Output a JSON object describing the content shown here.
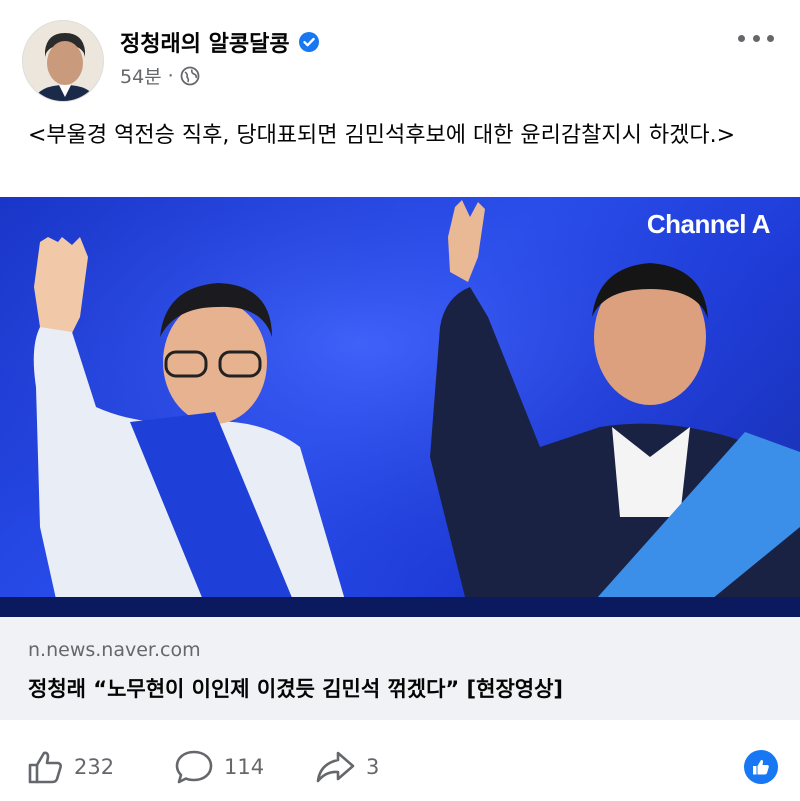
{
  "post": {
    "author": "정청래의 알콩달콩",
    "time": "54분",
    "separator": "·",
    "text": "<부울경 역전승 직후, 당대표되면 김민석후보에 대한 윤리감찰지시 하겠다.>"
  },
  "media": {
    "watermark": "Channel A"
  },
  "link_card": {
    "domain": "n.news.naver.com",
    "title": "정청래 “노무현이 이인제 이겼듯 김민석 꺾겠다” [현장영상]"
  },
  "actions": {
    "likes": "232",
    "comments": "114",
    "shares": "3"
  },
  "colors": {
    "accent": "#1877f2",
    "muted": "#65676b",
    "media_bg": "#2a4ff0",
    "card_bg": "#f0f2f5"
  },
  "icons": [
    "verified-badge-icon",
    "globe-icon",
    "more-options-icon",
    "like-icon",
    "comment-icon",
    "share-icon",
    "like-reaction-icon"
  ]
}
